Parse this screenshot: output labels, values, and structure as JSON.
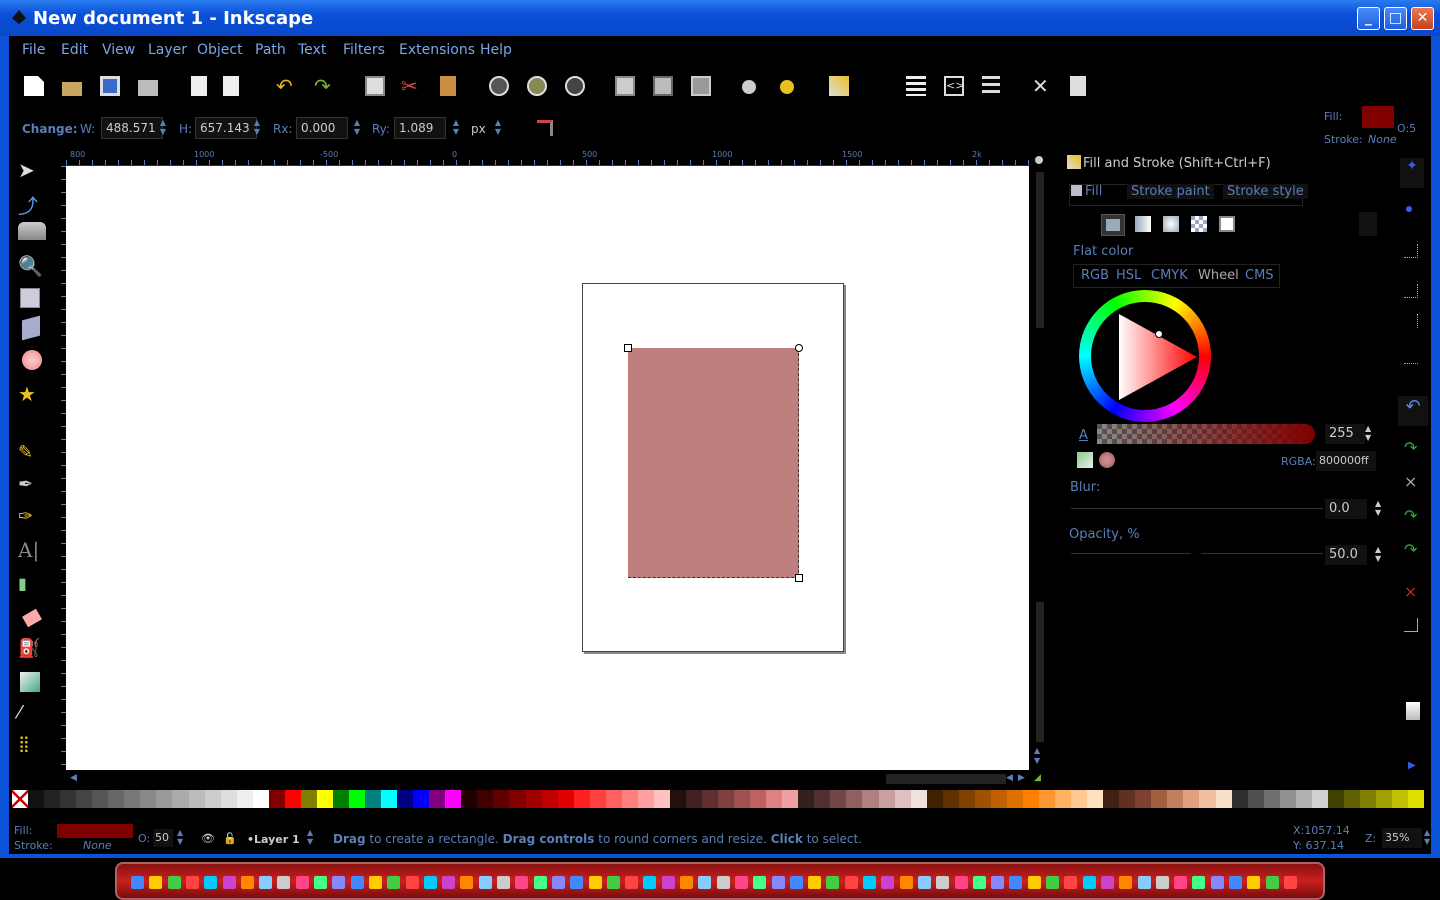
{
  "window": {
    "title": "New document 1 - Inkscape",
    "min": "_",
    "max": "□",
    "close": "✕"
  },
  "menu": [
    "File",
    "Edit",
    "View",
    "Layer",
    "Object",
    "Path",
    "Text",
    "Filters",
    "Extensions",
    "Help"
  ],
  "controls": {
    "change_label": "Change:",
    "w_label": "W:",
    "w_value": "488.571",
    "h_label": "H:",
    "h_value": "657.143",
    "rx_label": "Rx:",
    "rx_value": "0.000",
    "ry_label": "Ry:",
    "ry_value": "1.089",
    "unit": "px"
  },
  "fill_indicator": {
    "fill_label": "Fill:",
    "stroke_label": "Stroke:",
    "stroke_value": "None",
    "opacity": "O:5",
    "fill_color": "#800000"
  },
  "ruler_h_ticks": [
    "800",
    "1000",
    "-500",
    "0",
    "500",
    "1000",
    "1500",
    "2k"
  ],
  "dialog": {
    "title": "Fill and Stroke (Shift+Ctrl+F)",
    "tabs": [
      "Fill",
      "Stroke paint",
      "Stroke style"
    ],
    "flat_color": "Flat color",
    "modes": [
      "RGB",
      "HSL",
      "CMYK",
      "Wheel",
      "CMS"
    ],
    "alpha_label": "A",
    "alpha_value": "255",
    "rgba_label": "RGBA:",
    "rgba_value": "800000ff",
    "blur_label": "Blur:",
    "blur_value": "0.0",
    "opacity_label": "Opacity, %",
    "opacity_value": "50.0"
  },
  "status": {
    "fill_label": "Fill:",
    "stroke_label": "Stroke:",
    "stroke_value": "None",
    "opacity_label": "O:",
    "opacity_value": "50",
    "layer": "•Layer 1",
    "msg_1": "Drag",
    "msg_2": " to create a rectangle. ",
    "msg_3": "Drag controls",
    "msg_4": " to round corners and resize. ",
    "msg_5": "Click",
    "msg_6": " to select.",
    "x": "X:1057.14",
    "y": "Y: 637.14",
    "zoom_label": "Z:",
    "zoom_value": "35%"
  },
  "colors": {
    "accent": "#0a52d8",
    "ui_text": "#5a7fb8",
    "rect_fill": "#bf7f7f",
    "fill": "#800000"
  }
}
